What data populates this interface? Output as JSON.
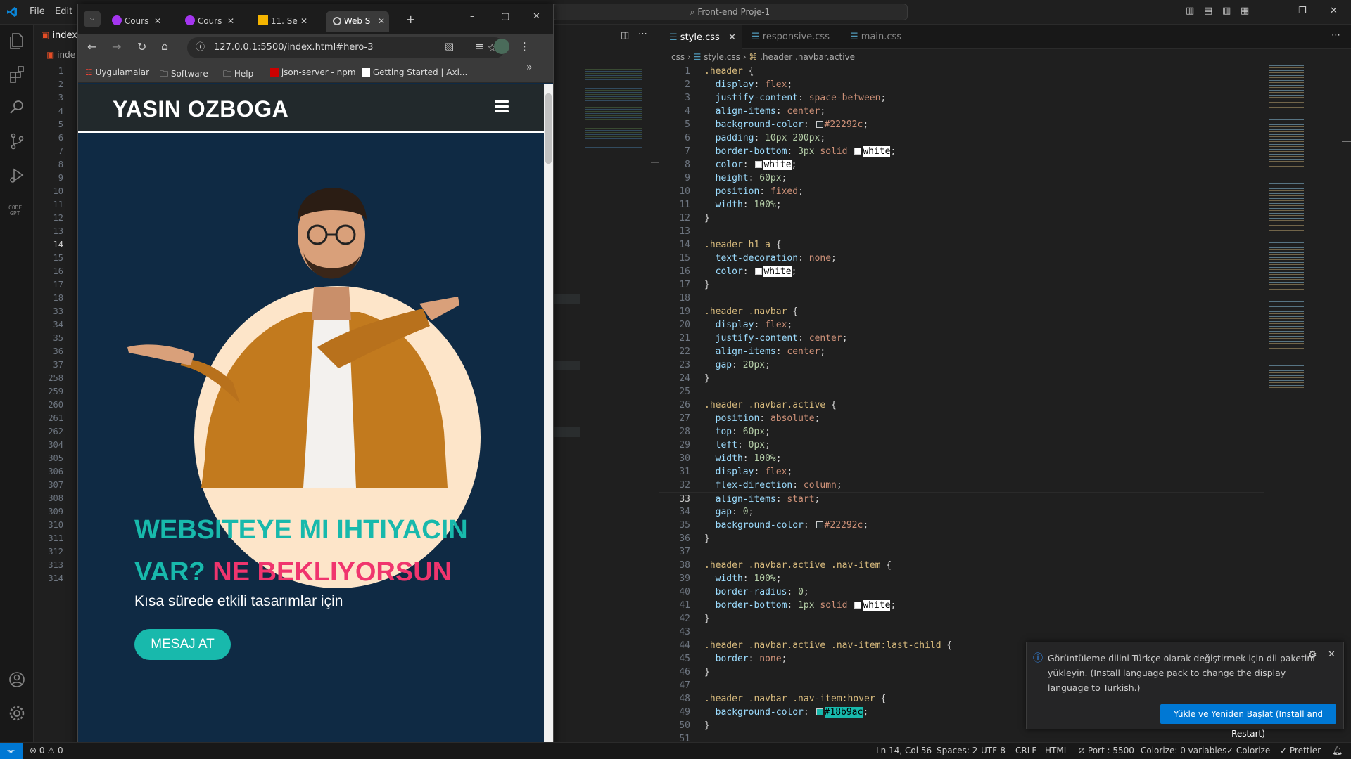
{
  "vscode": {
    "menu": [
      "File",
      "Edit"
    ],
    "command_center": "Front-end Proje-1",
    "left_editor": {
      "tab_label": "index",
      "crumb_label": "inde",
      "line_numbers": [
        "1",
        "2",
        "3",
        "4",
        "5",
        "6",
        "7",
        "8",
        "9",
        "10",
        "11",
        "12",
        "13",
        "14",
        "15",
        "16",
        "17",
        "18",
        "33",
        "34",
        "35",
        "36",
        "37",
        "258",
        "259",
        "260",
        "261",
        "262",
        "304",
        "305",
        "306",
        "307",
        "308",
        "309",
        "310",
        "311",
        "312",
        "313",
        "314"
      ],
      "current_line": "14"
    },
    "right_editor": {
      "tabs": [
        {
          "label": "style.css",
          "active": true
        },
        {
          "label": "responsive.css",
          "active": false
        },
        {
          "label": "main.css",
          "active": false
        }
      ],
      "breadcrumb": {
        "folder": "css",
        "file": "style.css",
        "symbol": ".header .navbar.active"
      },
      "current_line": "33"
    },
    "notification": {
      "message": "Görüntüleme dilini Türkçe olarak değiştirmek için dil paketini yükleyin. (Install language pack to change the display language to Turkish.)",
      "button": "Yükle ve Yeniden Başlat (Install and Restart)"
    },
    "status": {
      "errors": "0",
      "warnings": "0",
      "position": "Ln 14, Col 56",
      "spaces": "Spaces: 2",
      "encoding": "UTF-8",
      "eol": "CRLF",
      "language": "HTML",
      "port": "Port : 5500",
      "colorize": "Colorize: 0 variables",
      "colorize_btn": "Colorize",
      "prettier": "Prettier"
    }
  },
  "browser": {
    "tabs": [
      {
        "label": "Cours"
      },
      {
        "label": "Cours"
      },
      {
        "label": "11. Se"
      },
      {
        "label": "Web S",
        "active": true
      }
    ],
    "url": "127.0.0.1:5500/index.html#hero-3",
    "bookmarks": [
      "Uygulamalar",
      "Software",
      "Help",
      "json-server - npm",
      "Getting Started | Axi..."
    ],
    "site": {
      "logo": "YASIN OZBOGA",
      "headline_1": "WEBSITEYE MI IHTIYACIN VAR?",
      "headline_2": "NE BEKLIYORSUN",
      "subtitle": "Kısa sürede etkili tasarımlar için",
      "cta": "MESAJ AT"
    }
  },
  "colors": {
    "accent": "#18b9ac",
    "pink": "#f0356e",
    "header_bg": "#22292c",
    "vscode_blue": "#0078d4"
  }
}
